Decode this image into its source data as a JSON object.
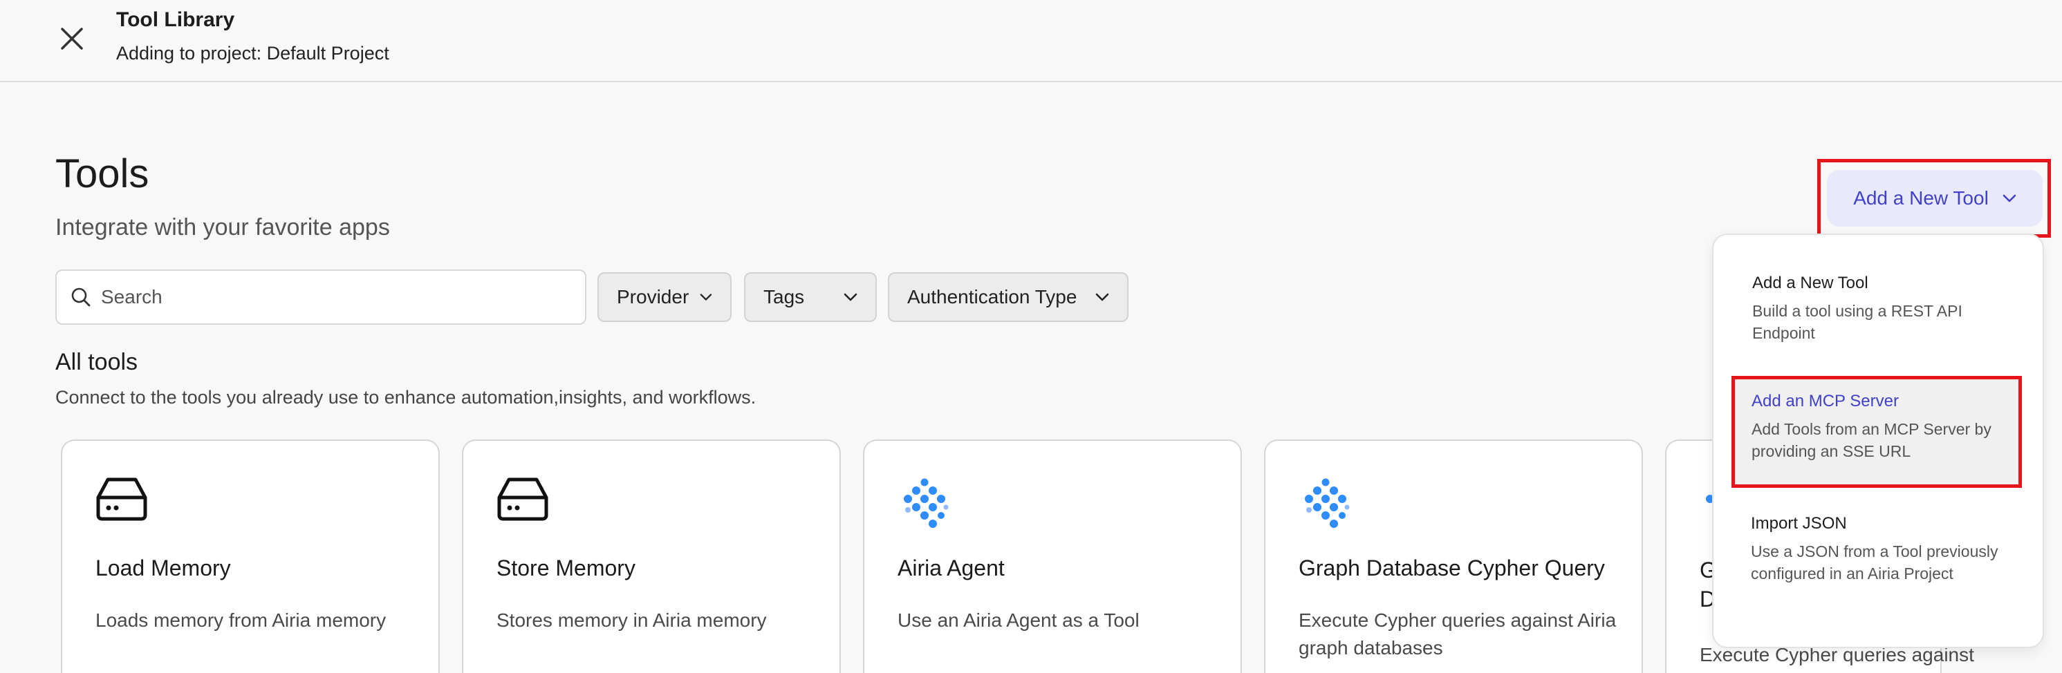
{
  "header": {
    "title": "Tool Library",
    "subtitle": "Adding to project: Default Project"
  },
  "page": {
    "title": "Tools",
    "subtitle": "Integrate with your favorite apps"
  },
  "search": {
    "placeholder": "Search"
  },
  "filters": {
    "provider": "Provider",
    "tags": "Tags",
    "auth": "Authentication Type"
  },
  "section": {
    "title": "All tools",
    "subtitle": "Connect to the tools you already use to enhance automation,insights, and workflows."
  },
  "cards": [
    {
      "title": "Load Memory",
      "desc": "Loads memory from Airia memory",
      "icon": "drive-icon"
    },
    {
      "title": "Store Memory",
      "desc": "Stores memory in Airia memory",
      "icon": "drive-icon"
    },
    {
      "title": "Airia Agent",
      "desc": "Use an Airia Agent as a Tool",
      "icon": "airia-logo-icon"
    },
    {
      "title": "Graph Database Cypher Query",
      "desc": "Execute Cypher queries against Airia graph databases",
      "icon": "airia-logo-icon"
    },
    {
      "title": "Graph Database Cypher Query",
      "title_visible": "G",
      "title_visible_2": "D",
      "desc": "Execute Cypher queries against",
      "icon": "airia-logo-icon"
    }
  ],
  "add_tool_button": {
    "label": "Add a New Tool"
  },
  "dropdown": {
    "items": [
      {
        "title": "Add a New Tool",
        "desc": "Build a tool using a REST API Endpoint"
      },
      {
        "title": "Add an MCP Server",
        "desc": "Add Tools from an MCP Server by providing an SSE URL"
      },
      {
        "title": "Import JSON",
        "desc": "Use a JSON from a Tool previously configured in an Airia Project"
      }
    ]
  },
  "colors": {
    "accent": "#4140c8",
    "accent_bg": "#e8e9fb",
    "highlight": "#e8141b",
    "logo_blue": "#2f8cff"
  }
}
